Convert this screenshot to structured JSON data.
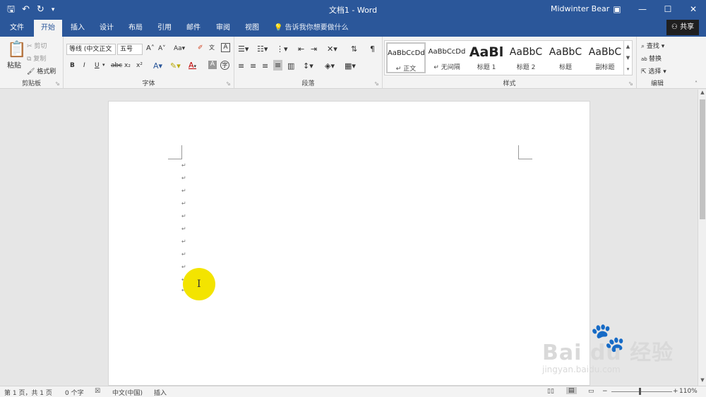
{
  "titlebar": {
    "doc_title": "文档1 - Word",
    "user_name": "Midwinter Bear",
    "bg_color": "#2b579a"
  },
  "tabs": [
    {
      "label": "文件"
    },
    {
      "label": "开始"
    },
    {
      "label": "插入"
    },
    {
      "label": "设计"
    },
    {
      "label": "布局"
    },
    {
      "label": "引用"
    },
    {
      "label": "邮件"
    },
    {
      "label": "审阅"
    },
    {
      "label": "视图"
    }
  ],
  "tellme": {
    "label": "告诉我你想要做什么"
  },
  "share": {
    "label": "共享"
  },
  "clipboard": {
    "paste": "粘贴",
    "cut": "剪切",
    "copy": "复制",
    "format_painter": "格式刷",
    "group_label": "剪贴板"
  },
  "font": {
    "font_name": "等线 (中文正文",
    "font_size": "五号",
    "bold": "B",
    "italic": "I",
    "underline": "U",
    "strike": "abc",
    "subscript": "x₂",
    "superscript": "x²",
    "font_color": "A",
    "grow": "A",
    "shrink": "A",
    "case": "Aa",
    "group_label": "字体"
  },
  "paragraph": {
    "group_label": "段落"
  },
  "styles": {
    "items": [
      {
        "sample": "AaBbCcDd",
        "name": "↵ 正文"
      },
      {
        "sample": "AaBbCcDd",
        "name": "↵ 无间隔"
      },
      {
        "sample": "AaBl",
        "name": "标题 1"
      },
      {
        "sample": "AaBbC",
        "name": "标题 2"
      },
      {
        "sample": "AaBbC",
        "name": "标题"
      },
      {
        "sample": "AaBbC",
        "name": "副标题"
      }
    ],
    "group_label": "样式"
  },
  "editing": {
    "find": "查找",
    "replace": "替换",
    "select": "选择",
    "group_label": "编辑"
  },
  "document": {
    "para_mark": "↵"
  },
  "statusbar": {
    "page": "第 1 页，共 1 页",
    "words": "0 个字",
    "language": "中文(中国)",
    "mode": "插入",
    "zoom": "110%"
  },
  "watermark": {
    "logo": "Bai du 经验",
    "url": "jingyan.baidu.com"
  }
}
